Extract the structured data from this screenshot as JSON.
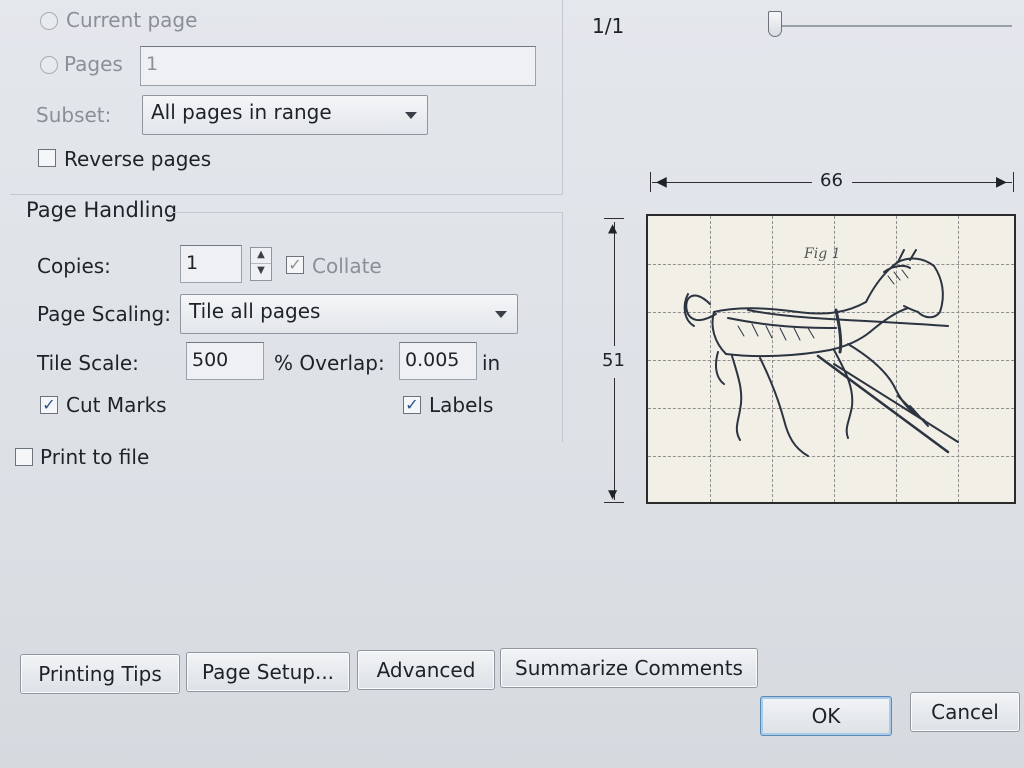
{
  "page_range": {
    "current_page_label": "Current page",
    "pages_label": "Pages",
    "pages_value": "1",
    "subset_label": "Subset:",
    "subset_value": "All pages in range",
    "reverse_label": "Reverse pages"
  },
  "page_handling": {
    "title": "Page Handling",
    "copies_label": "Copies:",
    "copies_value": "1",
    "collate_label": "Collate",
    "collate_checked": true,
    "scaling_label": "Page Scaling:",
    "scaling_value": "Tile all pages",
    "tile_scale_label": "Tile Scale:",
    "tile_scale_value": "500",
    "overlap_label": "% Overlap:",
    "overlap_value": "0.005",
    "overlap_unit": "in",
    "cut_marks_label": "Cut Marks",
    "cut_marks_checked": true,
    "labels_label": "Labels",
    "labels_checked": true
  },
  "print_to_file_label": "Print to file",
  "preview": {
    "page_counter": "1/1",
    "width_label": "66",
    "height_label": "51",
    "image_caption": "Fig 1",
    "image_icon": "horse-drawing-icon",
    "zoom_level": 0.0
  },
  "buttons": {
    "printing_tips": "Printing Tips",
    "page_setup": "Page Setup...",
    "advanced": "Advanced",
    "summarize_comments": "Summarize Comments",
    "ok": "OK",
    "cancel": "Cancel"
  },
  "colors": {
    "dialog_bg": "#dde1e6",
    "accent": "#5a8ab5",
    "preview_bg": "#f1efe6"
  }
}
